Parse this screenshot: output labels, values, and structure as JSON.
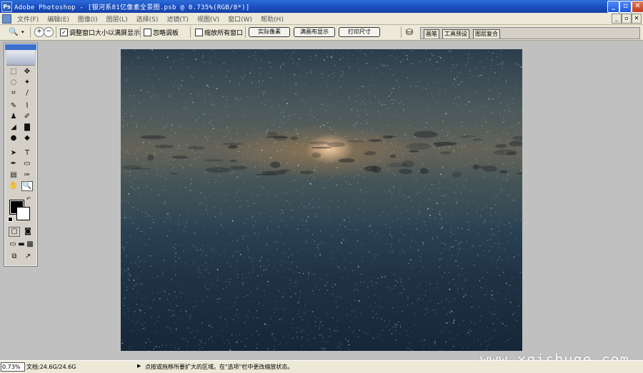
{
  "window": {
    "title": "Adobe Photoshop - [银河系81亿像素全景图.psb @ 0.735%(RGB/8*)]",
    "app_icon_text": "Ps",
    "minimize": "_",
    "maximize": "▫",
    "close": "✕"
  },
  "menubar": {
    "items": [
      "文件(F)",
      "编辑(E)",
      "图像(I)",
      "图层(L)",
      "选择(S)",
      "滤镜(T)",
      "视图(V)",
      "窗口(W)",
      "帮助(H)"
    ],
    "doc_minimize": "_",
    "doc_restore": "▫",
    "doc_close": "✕"
  },
  "optionsbar": {
    "tool_icon": "🔍",
    "zoom_in": "+",
    "zoom_out": "−",
    "resize_windows": {
      "checked": true,
      "label": "调整窗口大小以满屏显示"
    },
    "ignore_palettes": {
      "checked": false,
      "label": "忽略调板"
    },
    "zoom_all_windows": {
      "checked": false,
      "label": "缩放所有窗口"
    },
    "actual_pixels": "实际像素",
    "fit_on_screen": "满画布显示",
    "print_size": "打印尺寸"
  },
  "palette_well": {
    "tabs": [
      "画笔",
      "工具预设",
      "图层复合"
    ]
  },
  "toolbox": {
    "tools": [
      [
        "⬚",
        "✥"
      ],
      [
        "◌",
        "✦"
      ],
      [
        "⌗",
        "∕"
      ],
      [
        "✎",
        "⌇"
      ],
      [
        "♟",
        "✐"
      ],
      [
        "◢",
        "▇"
      ],
      [
        "●",
        "◆"
      ],
      [
        "➤",
        "T"
      ],
      [
        "✒",
        "▭"
      ],
      [
        "▤",
        "✑"
      ],
      [
        "✋",
        "🔍"
      ]
    ],
    "swap_arrow": "↶",
    "mode_buttons": [
      "▢",
      "◙"
    ],
    "screen_buttons": [
      "▭",
      "▬",
      "▩"
    ],
    "jump_buttons": [
      "⧉",
      "↗"
    ]
  },
  "statusbar": {
    "zoom": "0.73%",
    "doc_size": "文档:24.6G/24.6G",
    "arrow": "▶",
    "hint": "点按或拖移所要扩大的区域。在\"选项\"栏中更改缩放状态。"
  },
  "watermark": "www.xqishuge.com",
  "colors": {
    "title_bar": "#1a4fc0",
    "workspace": "#c0c0c0",
    "chrome": "#ece9d8",
    "foreground": "#000000",
    "background": "#ffffff"
  }
}
